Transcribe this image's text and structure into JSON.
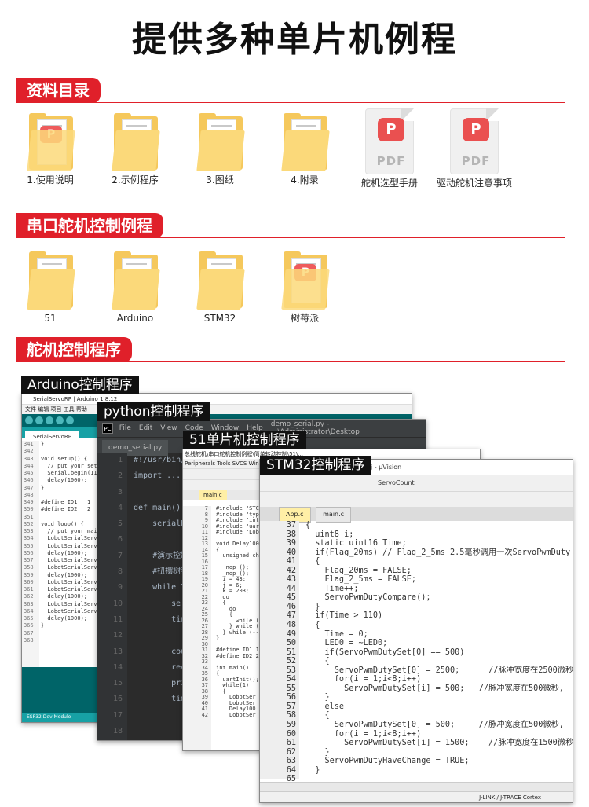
{
  "title": "提供多种单片机例程",
  "sections": {
    "s1": "资料目录",
    "s2": "串口舵机控制例程",
    "s3": "舵机控制程序"
  },
  "files1": [
    "1.使用说明",
    "2.示例程序",
    "3.图纸",
    "4.附录",
    "舵机选型手册",
    "驱动舵机注意事项"
  ],
  "files2": [
    "51",
    "Arduino",
    "STM32",
    "树莓派"
  ],
  "pdf_text": "PDF",
  "windows": {
    "arduino": {
      "label": "Arduino控制程序",
      "title": "SerialServoRP | Arduino 1.8.12",
      "menu": "文件 编辑 项目 工具 帮助",
      "tab": "SerialServoRP",
      "status": "ESP32 Dev Module",
      "lines": "341\n342\n343\n344\n345\n346\n347\n348\n349\n350\n351\n352\n353\n354\n355\n356\n357\n358\n359\n360\n361\n362\n363\n364\n365\n366\n367\n368",
      "code": "}\n\nvoid setup() {\n  // put your setu\n  Serial.begin(11\n  delay(1000);\n}\n\n#define ID1   1\n#define ID2   2\n\nvoid loop() {\n  // put your main\n  LobotSerialServ\n  LobotSerialServ\n  delay(1000);\n  LobotSerialServ\n  LobotSerialServ\n  delay(1000);\n  LobotSerialServ\n  LobotSerialServ\n  delay(1000);\n  LobotSerialServ\n  LobotSerialServ\n  delay(1000);\n}\n"
    },
    "python": {
      "label": "python控制程序",
      "menu": [
        "File",
        "Edit",
        "View",
        "Code",
        "Window",
        "Help"
      ],
      "path": "demo_serial.py - ...\\Administrator\\Desktop",
      "tab": "demo_serial.py",
      "lines": "1\n2\n3\n4\n5\n6\n7\n8\n9\n10\n11\n12\n13\n14\n15\n16\n17\n18\n19",
      "code": "#!/usr/bin/...\nimport ...\n\ndef main():\n    serialHa\n\n    #演示控制\n    #扭摆树莓\n    while T\n        seri\n        time\n\n        coun\n        recv\n        prin\n        time\n\n\nif __name__ ...:\n    main()"
    },
    "c51": {
      "label": "51单片机控制程序",
      "title": "总线舵机\\串口舵机控制例程\\简单转动控制\\51\\...",
      "menu": "Peripherals  Tools  SVCS  Window  Help",
      "tab": "main.c",
      "lines": "7\n8\n9\n10\n11\n12\n13\n14\n15\n16\n17\n18\n19\n20\n21\n22\n23\n24\n25\n26\n27\n28\n29\n30\n31\n32\n33\n34\n35\n36\n37\n38\n39\n40\n41\n42",
      "code": "#include \"STC\n#include \"typ\n#include \"int\n#include \"uar\n#include \"Lob\n\nvoid Delay100\n{\n  unsigned ch\n\n  _nop_();\n  _nop_();\n  i = 43;\n  j = 6;\n  k = 203;\n  do\n  {\n    do\n    {\n      while (\n    } while (\n  } while (--\n}\n\n#define ID1 1\n#define ID2 2\n\nint main()\n{\n  uartInit();\n  while(1)\n  {\n    LobotSer\n    LobotSer\n    Delay100\n    LobotSer"
    },
    "stm32": {
      "label": "STM32控制程序",
      "title": "...控制\\Pro\\APP.uvproj - µVision",
      "combo": "ServoCount",
      "tab_active": "App.c",
      "tab_other": "main.c",
      "status": "J-LINK / J-TRACE Cortex",
      "lines": "37\n38\n39\n40\n41\n42\n43\n44\n45\n46\n47\n48\n49\n50\n51\n52\n53\n54\n55\n56\n57\n58\n59\n60\n61\n62\n63\n64\n65",
      "code": "{\n  uint8 i;\n  static uint16 Time;\n  if(Flag_20ms) // Flag_2_5ms 2.5毫秒调用一次ServoPwmDuty\n  {\n    Flag_20ms = FALSE;\n    Flag_2_5ms = FALSE;\n    Time++;\n    ServoPwmDutyCompare();\n  }\n  if(Time > 110)\n  {\n    Time = 0;\n    LED0 = ~LED0;\n    if(ServoPwmDutySet[0] == 500)\n    {\n      ServoPwmDutySet[0] = 2500;      //脉冲宽度在2500微秒\n      for(i = 1;i<8;i++)\n        ServoPwmDutySet[i] = 500;   //脉冲宽度在500微秒,\n    }\n    else\n    {\n      ServoPwmDutySet[0] = 500;     //脉冲宽度在500微秒,\n      for(i = 1;i<8;i++)\n        ServoPwmDutySet[i] = 1500;    //脉冲宽度在1500微秒\n    }\n    ServoPwmDutyHaveChange = TRUE;\n  }\n"
    }
  },
  "colors": {
    "accent": "#e0202a",
    "folder": "#f5c85c",
    "arduino": "#006468"
  }
}
